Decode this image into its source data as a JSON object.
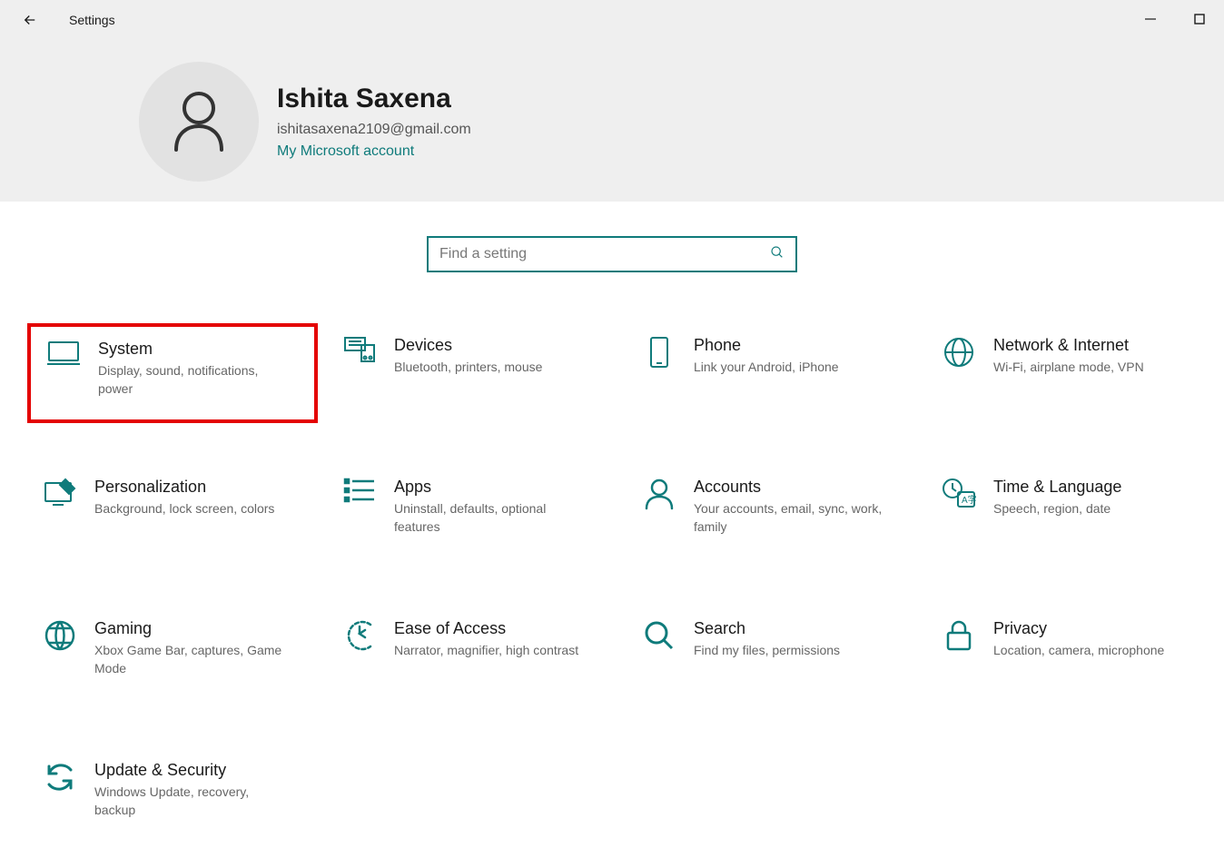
{
  "window": {
    "title": "Settings"
  },
  "profile": {
    "name": "Ishita Saxena",
    "email": "ishitasaxena2109@gmail.com",
    "account_link": "My Microsoft account"
  },
  "search": {
    "placeholder": "Find a setting"
  },
  "categories": [
    {
      "icon": "display-icon",
      "title": "System",
      "desc": "Display, sound, notifications, power",
      "highlighted": true
    },
    {
      "icon": "devices-icon",
      "title": "Devices",
      "desc": "Bluetooth, printers, mouse",
      "highlighted": false
    },
    {
      "icon": "phone-icon",
      "title": "Phone",
      "desc": "Link your Android, iPhone",
      "highlighted": false
    },
    {
      "icon": "globe-icon",
      "title": "Network & Internet",
      "desc": "Wi-Fi, airplane mode, VPN",
      "highlighted": false
    },
    {
      "icon": "personalization-icon",
      "title": "Personalization",
      "desc": "Background, lock screen, colors",
      "highlighted": false
    },
    {
      "icon": "apps-icon",
      "title": "Apps",
      "desc": "Uninstall, defaults, optional features",
      "highlighted": false
    },
    {
      "icon": "accounts-icon",
      "title": "Accounts",
      "desc": "Your accounts, email, sync, work, family",
      "highlighted": false
    },
    {
      "icon": "time-language-icon",
      "title": "Time & Language",
      "desc": "Speech, region, date",
      "highlighted": false
    },
    {
      "icon": "gaming-icon",
      "title": "Gaming",
      "desc": "Xbox Game Bar, captures, Game Mode",
      "highlighted": false
    },
    {
      "icon": "ease-of-access-icon",
      "title": "Ease of Access",
      "desc": "Narrator, magnifier, high contrast",
      "highlighted": false
    },
    {
      "icon": "search-cat-icon",
      "title": "Search",
      "desc": "Find my files, permissions",
      "highlighted": false
    },
    {
      "icon": "privacy-icon",
      "title": "Privacy",
      "desc": "Location, camera, microphone",
      "highlighted": false
    },
    {
      "icon": "update-icon",
      "title": "Update & Security",
      "desc": "Windows Update, recovery, backup",
      "highlighted": false
    }
  ]
}
